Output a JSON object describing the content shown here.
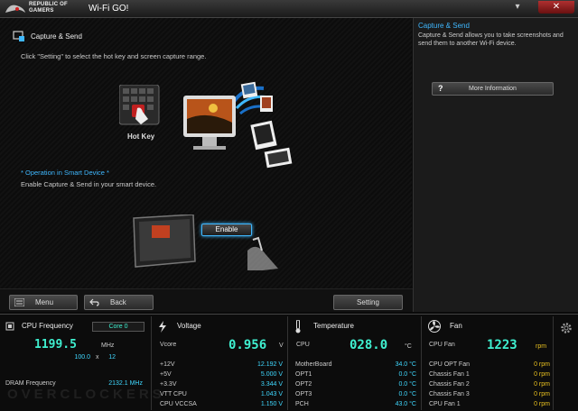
{
  "titlebar": {
    "brand_line1": "REPUBLIC OF",
    "brand_line2": "GAMERS",
    "app_title": "Wi-Fi GO!",
    "min_label": "▾",
    "close_label": "✕"
  },
  "main": {
    "section_title": "Capture & Send",
    "instruction": "Click \"Setting\" to select the hot key and screen capture range.",
    "hotkey_label": "Hot Key",
    "op_title": "* Operation in Smart Device *",
    "op_desc": "Enable Capture & Send in your smart device.",
    "enable_label": "Enable"
  },
  "sidebar": {
    "title": "Capture & Send",
    "description": "Capture & Send allows you to take screenshots and send them to another Wi-Fi device.",
    "more_label": "More Information",
    "more_icon": "?"
  },
  "buttons": {
    "menu": "Menu",
    "back": "Back",
    "setting": "Setting"
  },
  "cpu": {
    "title": "CPU Frequency",
    "core": "Core 0",
    "freq": "1199.5",
    "freq_unit": "MHz",
    "ratio_a": "100.0",
    "ratio_x": "x",
    "ratio_b": "12",
    "dram_label": "DRAM Frequency",
    "dram_value": "2132.1 MHz"
  },
  "voltage": {
    "title": "Voltage",
    "vcore_label": "Vcore",
    "vcore": "0.956",
    "vcore_unit": "V",
    "rows": [
      {
        "label": "+12V",
        "value": "12.192 V"
      },
      {
        "label": "+5V",
        "value": "5.000 V"
      },
      {
        "label": "+3.3V",
        "value": "3.344 V"
      },
      {
        "label": "VTT CPU",
        "value": "1.043 V"
      },
      {
        "label": "CPU VCCSA",
        "value": "1.150 V"
      }
    ]
  },
  "temperature": {
    "title": "Temperature",
    "cpu_label": "CPU",
    "cpu": "028.0",
    "cpu_unit": "°C",
    "rows": [
      {
        "label": "MotherBoard",
        "value": "34.0 °C"
      },
      {
        "label": "OPT1",
        "value": "0.0 °C"
      },
      {
        "label": "OPT2",
        "value": "0.0 °C"
      },
      {
        "label": "OPT3",
        "value": "0.0 °C"
      },
      {
        "label": "PCH",
        "value": "43.0 °C"
      }
    ]
  },
  "fan": {
    "title": "Fan",
    "cpu_label": "CPU Fan",
    "cpu": "1223",
    "cpu_unit": "rpm",
    "rows": [
      {
        "label": "CPU OPT Fan",
        "value": "0  rpm"
      },
      {
        "label": "Chassis Fan 1",
        "value": "0  rpm"
      },
      {
        "label": "Chassis Fan 2",
        "value": "0  rpm"
      },
      {
        "label": "Chassis Fan 3",
        "value": "0  rpm"
      },
      {
        "label": "CPU Fan 1",
        "value": "0  rpm"
      }
    ]
  },
  "watermark": "OVERCLOCKERS",
  "colors": {
    "accent": "#3fb8ff",
    "readout": "#3ff0d0",
    "fan_value": "#e8c020",
    "close": "#b03030"
  }
}
